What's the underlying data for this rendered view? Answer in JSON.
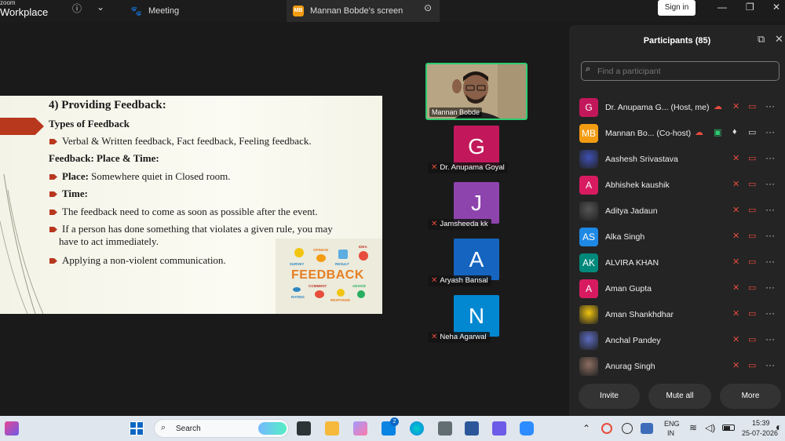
{
  "titlebar": {
    "logo_top": "zoom",
    "logo_bottom": "Workplace",
    "tab_meeting": "Meeting",
    "tab_screen_badge": "MB",
    "tab_screen": "Mannan Bobde's screen",
    "signin": "Sign in"
  },
  "slide": {
    "title": "4) Providing Feedback:",
    "types_heading": "Types of Feedback",
    "types_bullet": "Verbal & Written feedback, Fact feedback, Feeling feedback.",
    "place_time_heading": "Feedback: Place & Time:",
    "place_label": "Place:",
    "place_text": " Somewhere quiet in Closed room.",
    "time_label": "Time:",
    "bullet_time": "The feedback need to come as soon as possible after the event.",
    "bullet_rule_1": "If a person has done something that violates a given rule, you may",
    "bullet_rule_2": "have to act immediately.",
    "bullet_nvc": "Applying a non-violent communication.",
    "img_word": "FEEDBACK",
    "img_words": [
      "SURVEY",
      "OPINION",
      "RESULT",
      "IDEA",
      "COMMENT",
      "ADVICE",
      "RATING",
      "RESPONSE"
    ]
  },
  "videos": {
    "main_name": "Mannan Bobde",
    "tiles": [
      {
        "letter": "G",
        "name": "Dr. Anupama Goyal",
        "color": "#c2185b"
      },
      {
        "letter": "J",
        "name": "Jamsheeda kk",
        "color": "#8e44ad"
      },
      {
        "letter": "A",
        "name": "Aryash Bansal",
        "color": "#1565c0"
      },
      {
        "letter": "N",
        "name": "Neha Agarwal",
        "color": "#0288d1"
      }
    ]
  },
  "participants": {
    "title": "Participants (85)",
    "search_placeholder": "Find a participant",
    "rows": [
      {
        "initials": "G",
        "name": "Dr. Anupama G...  (Host, me)",
        "color": "#c2185b"
      },
      {
        "initials": "MB",
        "name": "Mannan Bo...  (Co-host)",
        "color": "#f39c12"
      },
      {
        "initials": "",
        "name": "Aashesh Srivastava",
        "color": "#3f51b5"
      },
      {
        "initials": "A",
        "name": "Abhishek kaushik",
        "color": "#d81b60"
      },
      {
        "initials": "",
        "name": "Aditya Jadaun",
        "color": "#555555"
      },
      {
        "initials": "AS",
        "name": "Alka Singh",
        "color": "#1e88e5"
      },
      {
        "initials": "AK",
        "name": "ALVIRA KHAN",
        "color": "#00897b"
      },
      {
        "initials": "A",
        "name": "Aman Gupta",
        "color": "#d81b60"
      },
      {
        "initials": "",
        "name": "Aman Shankhdhar",
        "color": "#f1c40f"
      },
      {
        "initials": "",
        "name": "Anchal Pandey",
        "color": "#5c6bc0"
      },
      {
        "initials": "",
        "name": "Anurag Singh",
        "color": "#8d6e63"
      }
    ],
    "invite": "Invite",
    "mute_all": "Mute all",
    "more": "More"
  },
  "taskbar": {
    "search": "Search",
    "lang_1": "ENG",
    "lang_2": "IN",
    "time": "15:39",
    "date": "25-07-2026",
    "store_badge": "2"
  }
}
